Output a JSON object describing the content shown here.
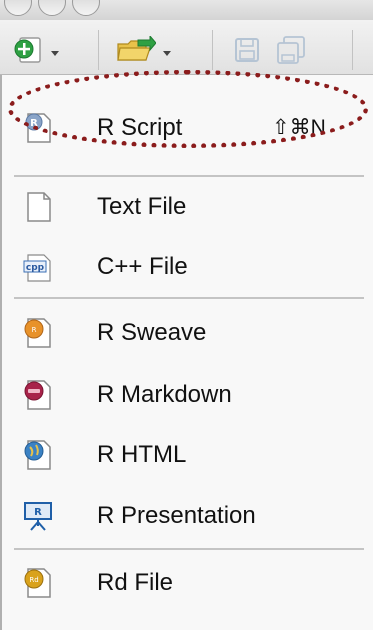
{
  "menu": {
    "items": [
      {
        "label": "R Script",
        "shortcut": "⇧⌘N",
        "icon": "r-script-icon"
      },
      {
        "label": "Text File",
        "icon": "text-file-icon"
      },
      {
        "label": "C++ File",
        "icon": "cpp-file-icon"
      },
      {
        "label": "R Sweave",
        "icon": "r-sweave-icon"
      },
      {
        "label": "R Markdown",
        "icon": "r-markdown-icon"
      },
      {
        "label": "R HTML",
        "icon": "r-html-icon"
      },
      {
        "label": "R Presentation",
        "icon": "r-presentation-icon"
      },
      {
        "label": "Rd File",
        "icon": "rd-file-icon"
      }
    ],
    "cpp_icon_text": "cpp"
  },
  "toolbar": {
    "icons": [
      "new-file-icon",
      "open-folder-icon",
      "save-icon",
      "save-all-icon"
    ]
  },
  "colors": {
    "highlight": "#8b1c1c",
    "green": "#2ea043",
    "sweave": "#e8922a",
    "markdown": "#a8234a",
    "html": "#3b82c4",
    "presentation": "#1f5fa8"
  }
}
